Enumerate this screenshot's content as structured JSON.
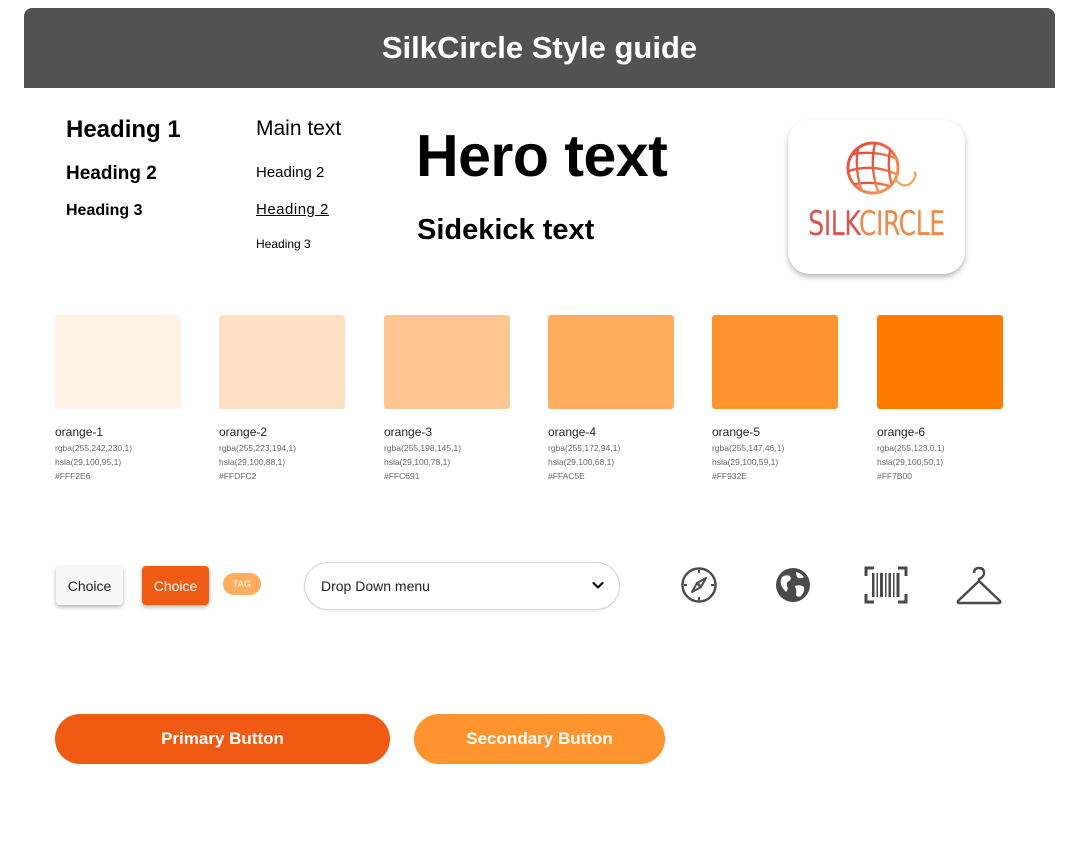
{
  "header": {
    "title": "SilkCircle Style guide"
  },
  "typography": {
    "col1": {
      "heading1": "Heading 1",
      "heading2": "Heading 2",
      "heading3": "Heading 3"
    },
    "col2": {
      "main_text": "Main text",
      "heading2": "Heading 2",
      "heading2_underlined": "Heading 2",
      "heading3": "Heading 3"
    },
    "hero": "Hero text",
    "sidekick": "Sidekick text"
  },
  "logo": {
    "word_part1": "SILK",
    "word_part2": "CIRCLE"
  },
  "swatches": [
    {
      "name": "orange-1",
      "rgba": "rgba(255,242,230,1)",
      "hsla": "hsla(29,100,95,1)",
      "hex": "#FFF2E6"
    },
    {
      "name": "orange-2",
      "rgba": "rgba(255,223,194,1)",
      "hsla": "hsla(29,100,88,1)",
      "hex": "#FFDFC2"
    },
    {
      "name": "orange-3",
      "rgba": "rgba(255,198,145,1)",
      "hsla": "hsla(29,100,78,1)",
      "hex": "#FFC691"
    },
    {
      "name": "orange-4",
      "rgba": "rgba(255,172,94,1)",
      "hsla": "hsla(29,100,68,1)",
      "hex": "#FFAC5E"
    },
    {
      "name": "orange-5",
      "rgba": "rgba(255,147,46,1)",
      "hsla": "hsla(29,100,59,1)",
      "hex": "#FF932E"
    },
    {
      "name": "orange-6",
      "rgba": "rgba(255,123,0,1)",
      "hsla": "hsla(29,100,50,1)",
      "hex": "#FF7B00"
    }
  ],
  "components": {
    "choice_light": "Choice",
    "choice_dark": "Choice",
    "tag": "TAG",
    "dropdown": {
      "selected": "Drop Down menu"
    }
  },
  "icons": [
    "compass-icon",
    "globe-icon",
    "barcode-scan-icon",
    "hanger-icon"
  ],
  "buttons": {
    "primary": "Primary Button",
    "secondary": "Secondary Button"
  },
  "colors": {
    "header_bg": "#525252",
    "primary": "#F15A12",
    "secondary": "#FF932E",
    "icon": "#4a4a4a"
  }
}
